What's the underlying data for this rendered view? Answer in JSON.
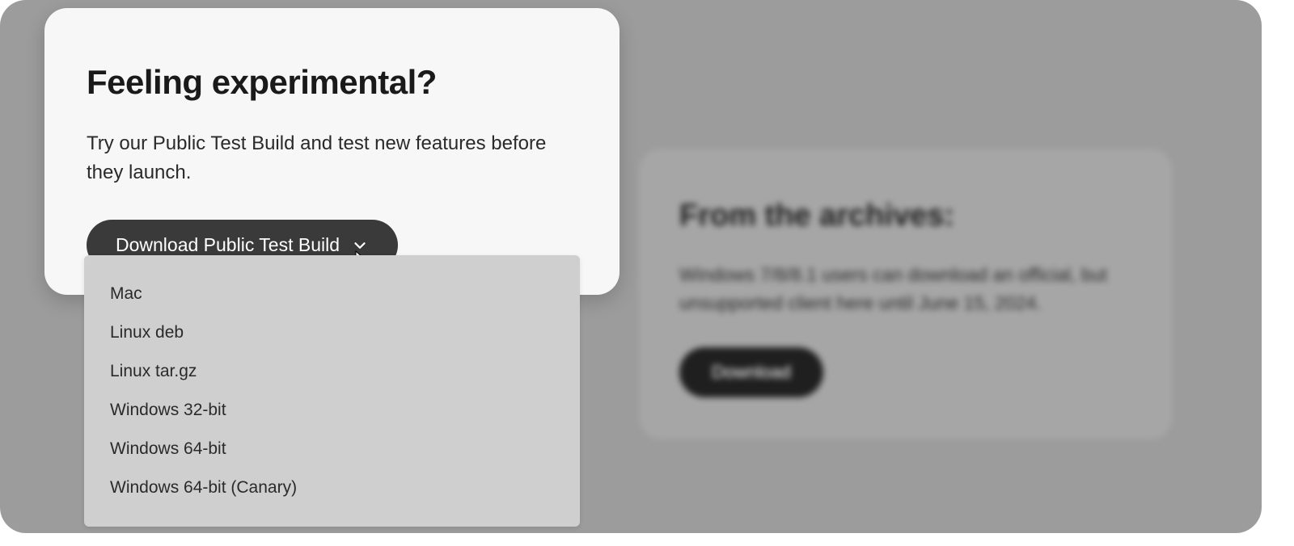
{
  "left_card": {
    "heading": "Feeling experimental?",
    "body": "Try our Public Test Build and test new features before they launch.",
    "button_label": "Download Public Test Build"
  },
  "dropdown": {
    "items": [
      {
        "label": "Mac"
      },
      {
        "label": "Linux deb"
      },
      {
        "label": "Linux tar.gz"
      },
      {
        "label": "Windows 32-bit"
      },
      {
        "label": "Windows 64-bit"
      },
      {
        "label": "Windows 64-bit (Canary)"
      }
    ]
  },
  "right_card": {
    "heading": "From the archives:",
    "body": "Windows 7/8/8.1 users can download an official, but unsupported client here until June 15, 2024.",
    "button_label": "Download"
  }
}
